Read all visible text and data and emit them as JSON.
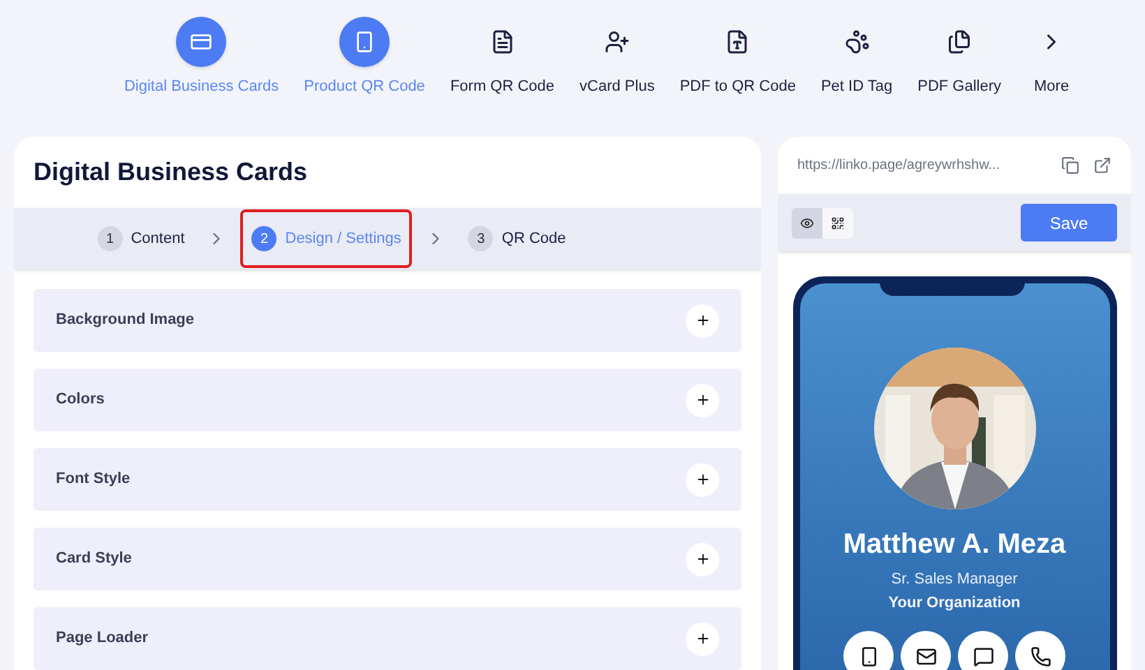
{
  "nav": [
    {
      "label": "Digital Business Cards",
      "selected": true
    },
    {
      "label": "Product QR Code",
      "selected": true
    },
    {
      "label": "Form QR Code",
      "selected": false
    },
    {
      "label": "vCard Plus",
      "selected": false
    },
    {
      "label": "PDF to QR Code",
      "selected": false
    },
    {
      "label": "Pet ID Tag",
      "selected": false
    },
    {
      "label": "PDF Gallery",
      "selected": false
    },
    {
      "label": "More",
      "selected": false
    }
  ],
  "editor": {
    "title": "Digital Business Cards",
    "steps": [
      {
        "number": "1",
        "label": "Content",
        "selected": false
      },
      {
        "number": "2",
        "label": "Design / Settings",
        "selected": true
      },
      {
        "number": "3",
        "label": "QR Code",
        "selected": false
      }
    ],
    "sections": [
      {
        "label": "Background Image",
        "expanded": false
      },
      {
        "label": "Colors",
        "expanded": false
      },
      {
        "label": "Font Style",
        "expanded": false
      },
      {
        "label": "Card Style",
        "expanded": false
      },
      {
        "label": "Page Loader",
        "expanded": false
      }
    ]
  },
  "preview": {
    "url": "https://linko.page/agreywrhshw...",
    "views": [
      {
        "kind": "preview",
        "selected": true
      },
      {
        "kind": "qr",
        "selected": false
      }
    ],
    "save": "Save",
    "card": {
      "name": "Matthew A. Meza",
      "job_title": "Sr. Sales Manager",
      "organization": "Your Organization"
    }
  }
}
